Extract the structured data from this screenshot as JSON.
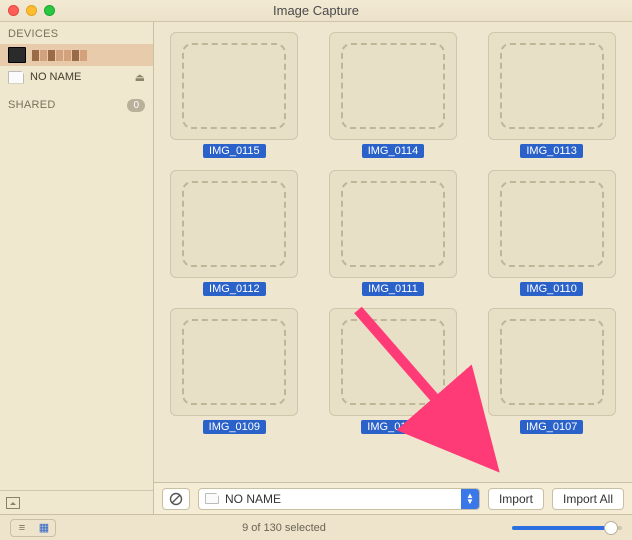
{
  "window": {
    "title": "Image Capture"
  },
  "sidebar": {
    "section_devices": "DEVICES",
    "section_shared": "SHARED",
    "shared_count": "0",
    "device": {
      "name_obscured": true
    },
    "volume": {
      "name": "NO NAME"
    }
  },
  "destination": {
    "label": "NO NAME"
  },
  "buttons": {
    "import": "Import",
    "import_all": "Import All"
  },
  "status": {
    "text": "9 of 130 selected"
  },
  "thumbnails": [
    {
      "label": "IMG_0115"
    },
    {
      "label": "IMG_0114"
    },
    {
      "label": "IMG_0113"
    },
    {
      "label": "IMG_0112"
    },
    {
      "label": "IMG_0111"
    },
    {
      "label": "IMG_0110"
    },
    {
      "label": "IMG_0109"
    },
    {
      "label": "IMG_0108"
    },
    {
      "label": "IMG_0107"
    }
  ]
}
